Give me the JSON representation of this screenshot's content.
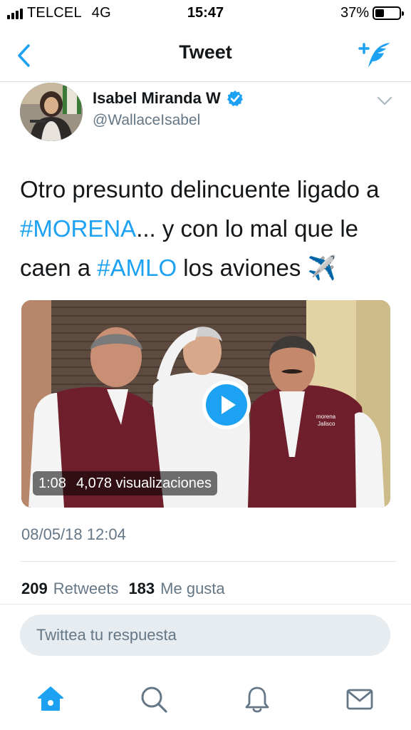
{
  "status_bar": {
    "carrier": "TELCEL",
    "network": "4G",
    "time": "15:47",
    "battery_pct": "37%",
    "battery_level": 0.37
  },
  "nav": {
    "title": "Tweet",
    "back_icon": "chevron-left-icon",
    "compose_icon": "compose-tweet-icon"
  },
  "tweet": {
    "author_name": "Isabel Miranda W",
    "author_handle": "@WallaceIsabel",
    "verified": true,
    "text_parts": {
      "p1": "Otro presunto delincuente ligado a ",
      "h1": "#MORENA",
      "p2": "... y con lo mal que le caen a ",
      "h2": "#AMLO",
      "p3": " los aviones ✈️"
    },
    "video": {
      "duration": "1:08",
      "views": "4,078 visualizaciones"
    },
    "timestamp": "08/05/18 12:04",
    "retweets_count": "209",
    "retweets_label": "Retweets",
    "likes_count": "183",
    "likes_label": "Me gusta"
  },
  "reply": {
    "placeholder": "Twittea tu respuesta"
  },
  "tab_bar": {
    "tabs": [
      "home-icon",
      "search-icon",
      "notifications-icon",
      "messages-icon"
    ],
    "active": "home-icon"
  },
  "colors": {
    "accent": "#1da1f2",
    "text": "#14171a",
    "secondary": "#657786",
    "reply_bg": "#e6ecf0"
  }
}
